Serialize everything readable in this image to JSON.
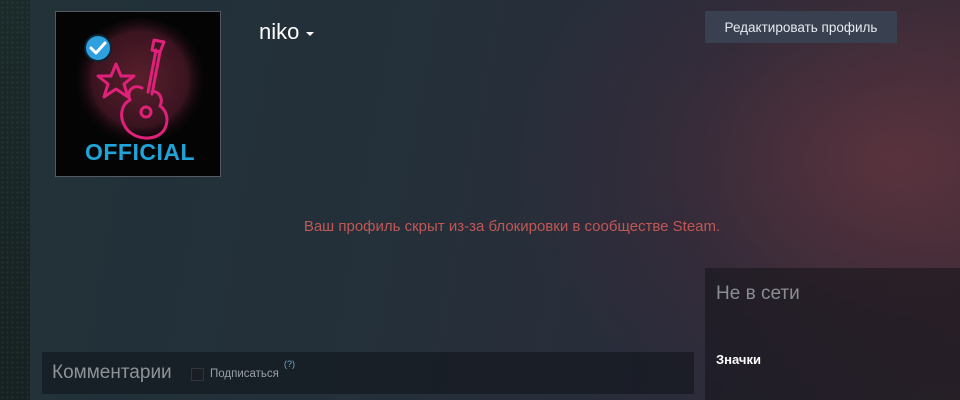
{
  "profile": {
    "persona_name": "niko",
    "avatar_text": "OFFICIAL",
    "verified": true
  },
  "header": {
    "edit_profile_label": "Редактировать профиль"
  },
  "notice": {
    "ban_message": "Ваш профиль скрыт из-за блокировки в сообществе Steam."
  },
  "status": {
    "online_state": "Не в сети",
    "badges_label": "Значки"
  },
  "comments": {
    "title": "Комментарии",
    "subscribe_label": "Подписаться",
    "help_label": "(?)",
    "subscribed": false
  },
  "colors": {
    "ban_message": "#c15755",
    "neon_pink": "#e0217a",
    "neon_blue": "#1fa3d8",
    "verified_badge": "#2ea0df"
  },
  "icons": [
    "verified-check-icon",
    "star-icon",
    "guitar-icon",
    "dropdown-caret-icon"
  ]
}
